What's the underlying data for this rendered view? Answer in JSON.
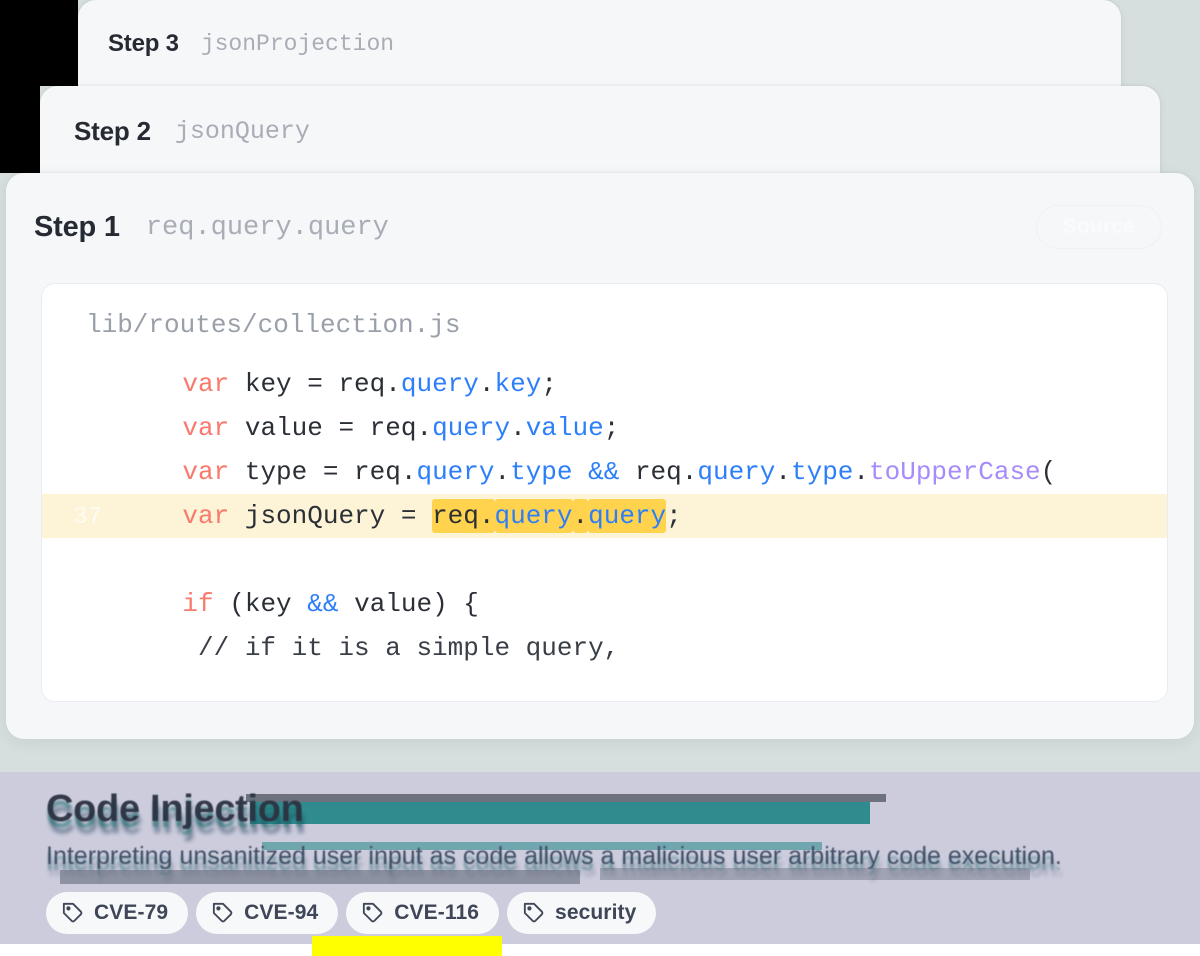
{
  "background": {
    "upper_panel_color": "#d7dfde",
    "lower_panel_color": "#ccccdc",
    "notch_color": "#000000"
  },
  "steps": [
    {
      "label": "Step 3",
      "expression": "jsonProjection"
    },
    {
      "label": "Step 2",
      "expression": "jsonQuery"
    },
    {
      "label": "Step 1",
      "expression": "req.query.query",
      "source_button": "Source"
    }
  ],
  "code_panel": {
    "filename": "lib/routes/collection.js",
    "highlight_line_number": "37",
    "highlight_token": "req.query.query",
    "highlight_row_background": "#fdf4d8",
    "highlight_token_background": "#ffd34d",
    "lines": [
      {
        "number": "",
        "text": "    var key = req.query.key;",
        "tokens": [
          {
            "t": "    ",
            "c": "ctxt"
          },
          {
            "t": "var",
            "c": "kw"
          },
          {
            "t": " key = req.",
            "c": "ctxt"
          },
          {
            "t": "query",
            "c": "prop"
          },
          {
            "t": ".",
            "c": "ctxt"
          },
          {
            "t": "key",
            "c": "prop"
          },
          {
            "t": ";",
            "c": "ctxt"
          }
        ]
      },
      {
        "number": "",
        "text": "    var value = req.query.value;",
        "tokens": [
          {
            "t": "    ",
            "c": "ctxt"
          },
          {
            "t": "var",
            "c": "kw"
          },
          {
            "t": " value = req.",
            "c": "ctxt"
          },
          {
            "t": "query",
            "c": "prop"
          },
          {
            "t": ".",
            "c": "ctxt"
          },
          {
            "t": "value",
            "c": "prop"
          },
          {
            "t": ";",
            "c": "ctxt"
          }
        ]
      },
      {
        "number": "",
        "text": "    var type = req.query.type && req.query.type.toUpperCase(",
        "tokens": [
          {
            "t": "    ",
            "c": "ctxt"
          },
          {
            "t": "var",
            "c": "kw"
          },
          {
            "t": " type = req.",
            "c": "ctxt"
          },
          {
            "t": "query",
            "c": "prop"
          },
          {
            "t": ".",
            "c": "ctxt"
          },
          {
            "t": "type",
            "c": "prop"
          },
          {
            "t": " ",
            "c": "ctxt"
          },
          {
            "t": "&&",
            "c": "op"
          },
          {
            "t": " req.",
            "c": "ctxt"
          },
          {
            "t": "query",
            "c": "prop"
          },
          {
            "t": ".",
            "c": "ctxt"
          },
          {
            "t": "type",
            "c": "prop"
          },
          {
            "t": ".",
            "c": "ctxt"
          },
          {
            "t": "toUpperCase",
            "c": "fn"
          },
          {
            "t": "(",
            "c": "ctxt"
          }
        ]
      },
      {
        "number": "37",
        "highlighted": true,
        "text": "    var jsonQuery = req.query.query;",
        "tokens": [
          {
            "t": "    ",
            "c": "ctxt"
          },
          {
            "t": "var",
            "c": "kw"
          },
          {
            "t": " jsonQuery = ",
            "c": "ctxt"
          },
          {
            "t": "req.",
            "c": "ctxt",
            "mark": true
          },
          {
            "t": "query",
            "c": "prop",
            "mark": true
          },
          {
            "t": ".",
            "c": "ctxt",
            "mark": true
          },
          {
            "t": "query",
            "c": "prop",
            "mark": true
          },
          {
            "t": ";",
            "c": "ctxt"
          }
        ]
      },
      {
        "number": "",
        "text": "",
        "tokens": []
      },
      {
        "number": "",
        "text": "    if (key && value) {",
        "tokens": [
          {
            "t": "    ",
            "c": "ctxt"
          },
          {
            "t": "if",
            "c": "kw"
          },
          {
            "t": " (key ",
            "c": "ctxt"
          },
          {
            "t": "&&",
            "c": "op"
          },
          {
            "t": " value) {",
            "c": "ctxt"
          }
        ]
      },
      {
        "number": "",
        "text": "     // if it is a simple query,",
        "tokens": [
          {
            "t": "     // if it is a simple query,",
            "c": "cmt"
          }
        ]
      }
    ]
  },
  "finding": {
    "title": "Code Injection",
    "description": "Interpreting unsanitized user input as code allows a malicious user arbitrary code execution.",
    "tags": [
      {
        "label": "CVE-79",
        "icon": "tag-icon"
      },
      {
        "label": "CVE-94",
        "icon": "tag-icon"
      },
      {
        "label": "CVE-116",
        "icon": "tag-icon"
      },
      {
        "label": "security",
        "icon": "tag-icon"
      }
    ]
  },
  "colors": {
    "keyword": "#f97a6d",
    "property": "#2d7ff9",
    "function": "#a78bfa",
    "plain": "#2b2f36",
    "highlight_yellow": "#ffd34d",
    "artifact_yellow": "#ffff00"
  }
}
